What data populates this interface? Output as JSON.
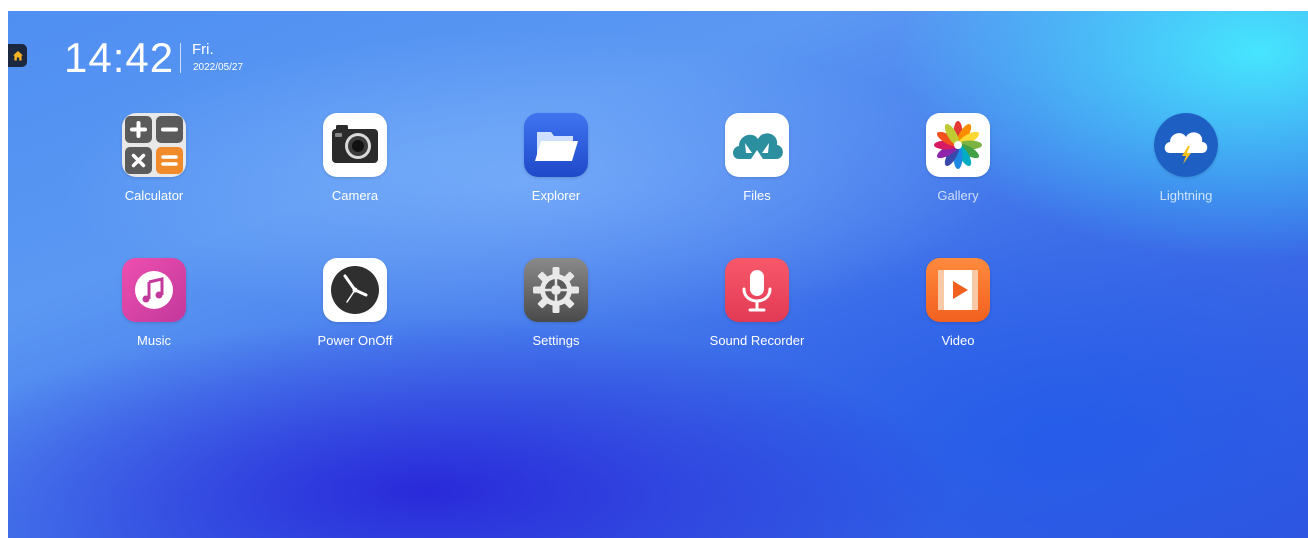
{
  "status": {
    "time": "14:42",
    "day": "Fri.",
    "date": "2022/05/27"
  },
  "apps": [
    {
      "label": "Calculator",
      "icon": "calculator-icon"
    },
    {
      "label": "Camera",
      "icon": "camera-icon"
    },
    {
      "label": "Explorer",
      "icon": "folder-icon"
    },
    {
      "label": "Files",
      "icon": "cloud-files-icon"
    },
    {
      "label": "Gallery",
      "icon": "gallery-flower-icon"
    },
    {
      "label": "Lightning",
      "icon": "cloud-lightning-icon"
    },
    {
      "label": "Music",
      "icon": "music-note-icon"
    },
    {
      "label": "Power OnOff",
      "icon": "power-clock-icon"
    },
    {
      "label": "Settings",
      "icon": "gear-icon"
    },
    {
      "label": "Sound Recorder",
      "icon": "microphone-icon"
    },
    {
      "label": "Video",
      "icon": "play-icon"
    }
  ],
  "colors": {
    "home_button": "#1c2740",
    "home_icon": "#f5b324",
    "background_top_right": "#46ebff",
    "background_bottom": "#261ed7"
  }
}
